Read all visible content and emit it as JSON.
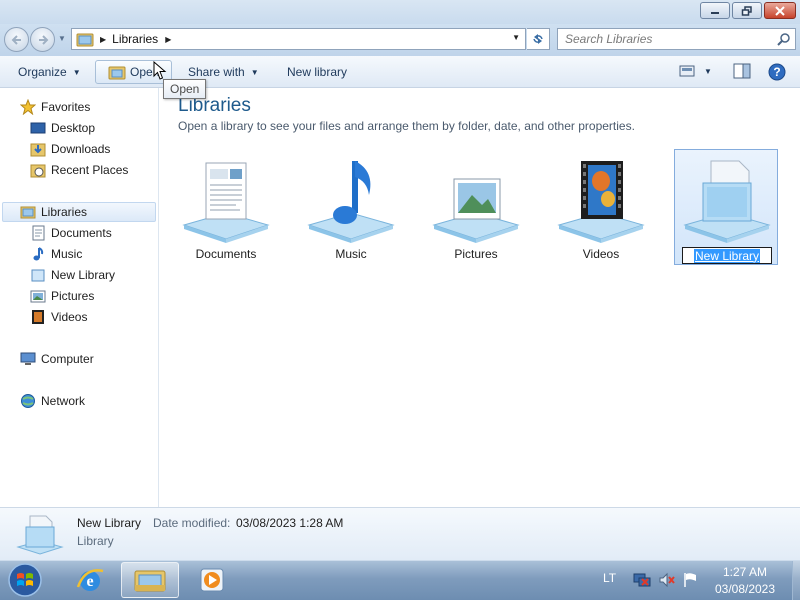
{
  "window": {
    "minimize_icon": "minimize-icon",
    "maximize_icon": "restore-icon",
    "close_icon": "close-icon"
  },
  "address": {
    "path": "Libraries",
    "search_placeholder": "Search Libraries"
  },
  "toolbar": {
    "organize": "Organize",
    "open": "Open",
    "share": "Share with",
    "new_library": "New library"
  },
  "tooltip": "Open",
  "nav": {
    "favorites": "Favorites",
    "desktop": "Desktop",
    "downloads": "Downloads",
    "recent": "Recent Places",
    "libraries": "Libraries",
    "documents": "Documents",
    "music": "Music",
    "new_library": "New Library",
    "pictures": "Pictures",
    "videos": "Videos",
    "computer": "Computer",
    "network": "Network"
  },
  "content": {
    "title": "Libraries",
    "subtitle": "Open a library to see your files and arrange them by folder, date, and other properties.",
    "libraries": [
      {
        "name": "Documents",
        "icon": "documents-library-icon"
      },
      {
        "name": "Music",
        "icon": "music-library-icon"
      },
      {
        "name": "Pictures",
        "icon": "pictures-library-icon"
      },
      {
        "name": "Videos",
        "icon": "videos-library-icon"
      },
      {
        "name": "New Library",
        "icon": "new-library-icon"
      }
    ]
  },
  "details": {
    "name": "New Library",
    "modified_label": "Date modified:",
    "modified_value": "03/08/2023 1:28 AM",
    "type": "Library"
  },
  "taskbar": {
    "lang": "LT",
    "time": "1:27 AM",
    "date": "03/08/2023"
  },
  "colors": {
    "title_blue": "#1e5a8c",
    "selection": "#3399ff"
  }
}
